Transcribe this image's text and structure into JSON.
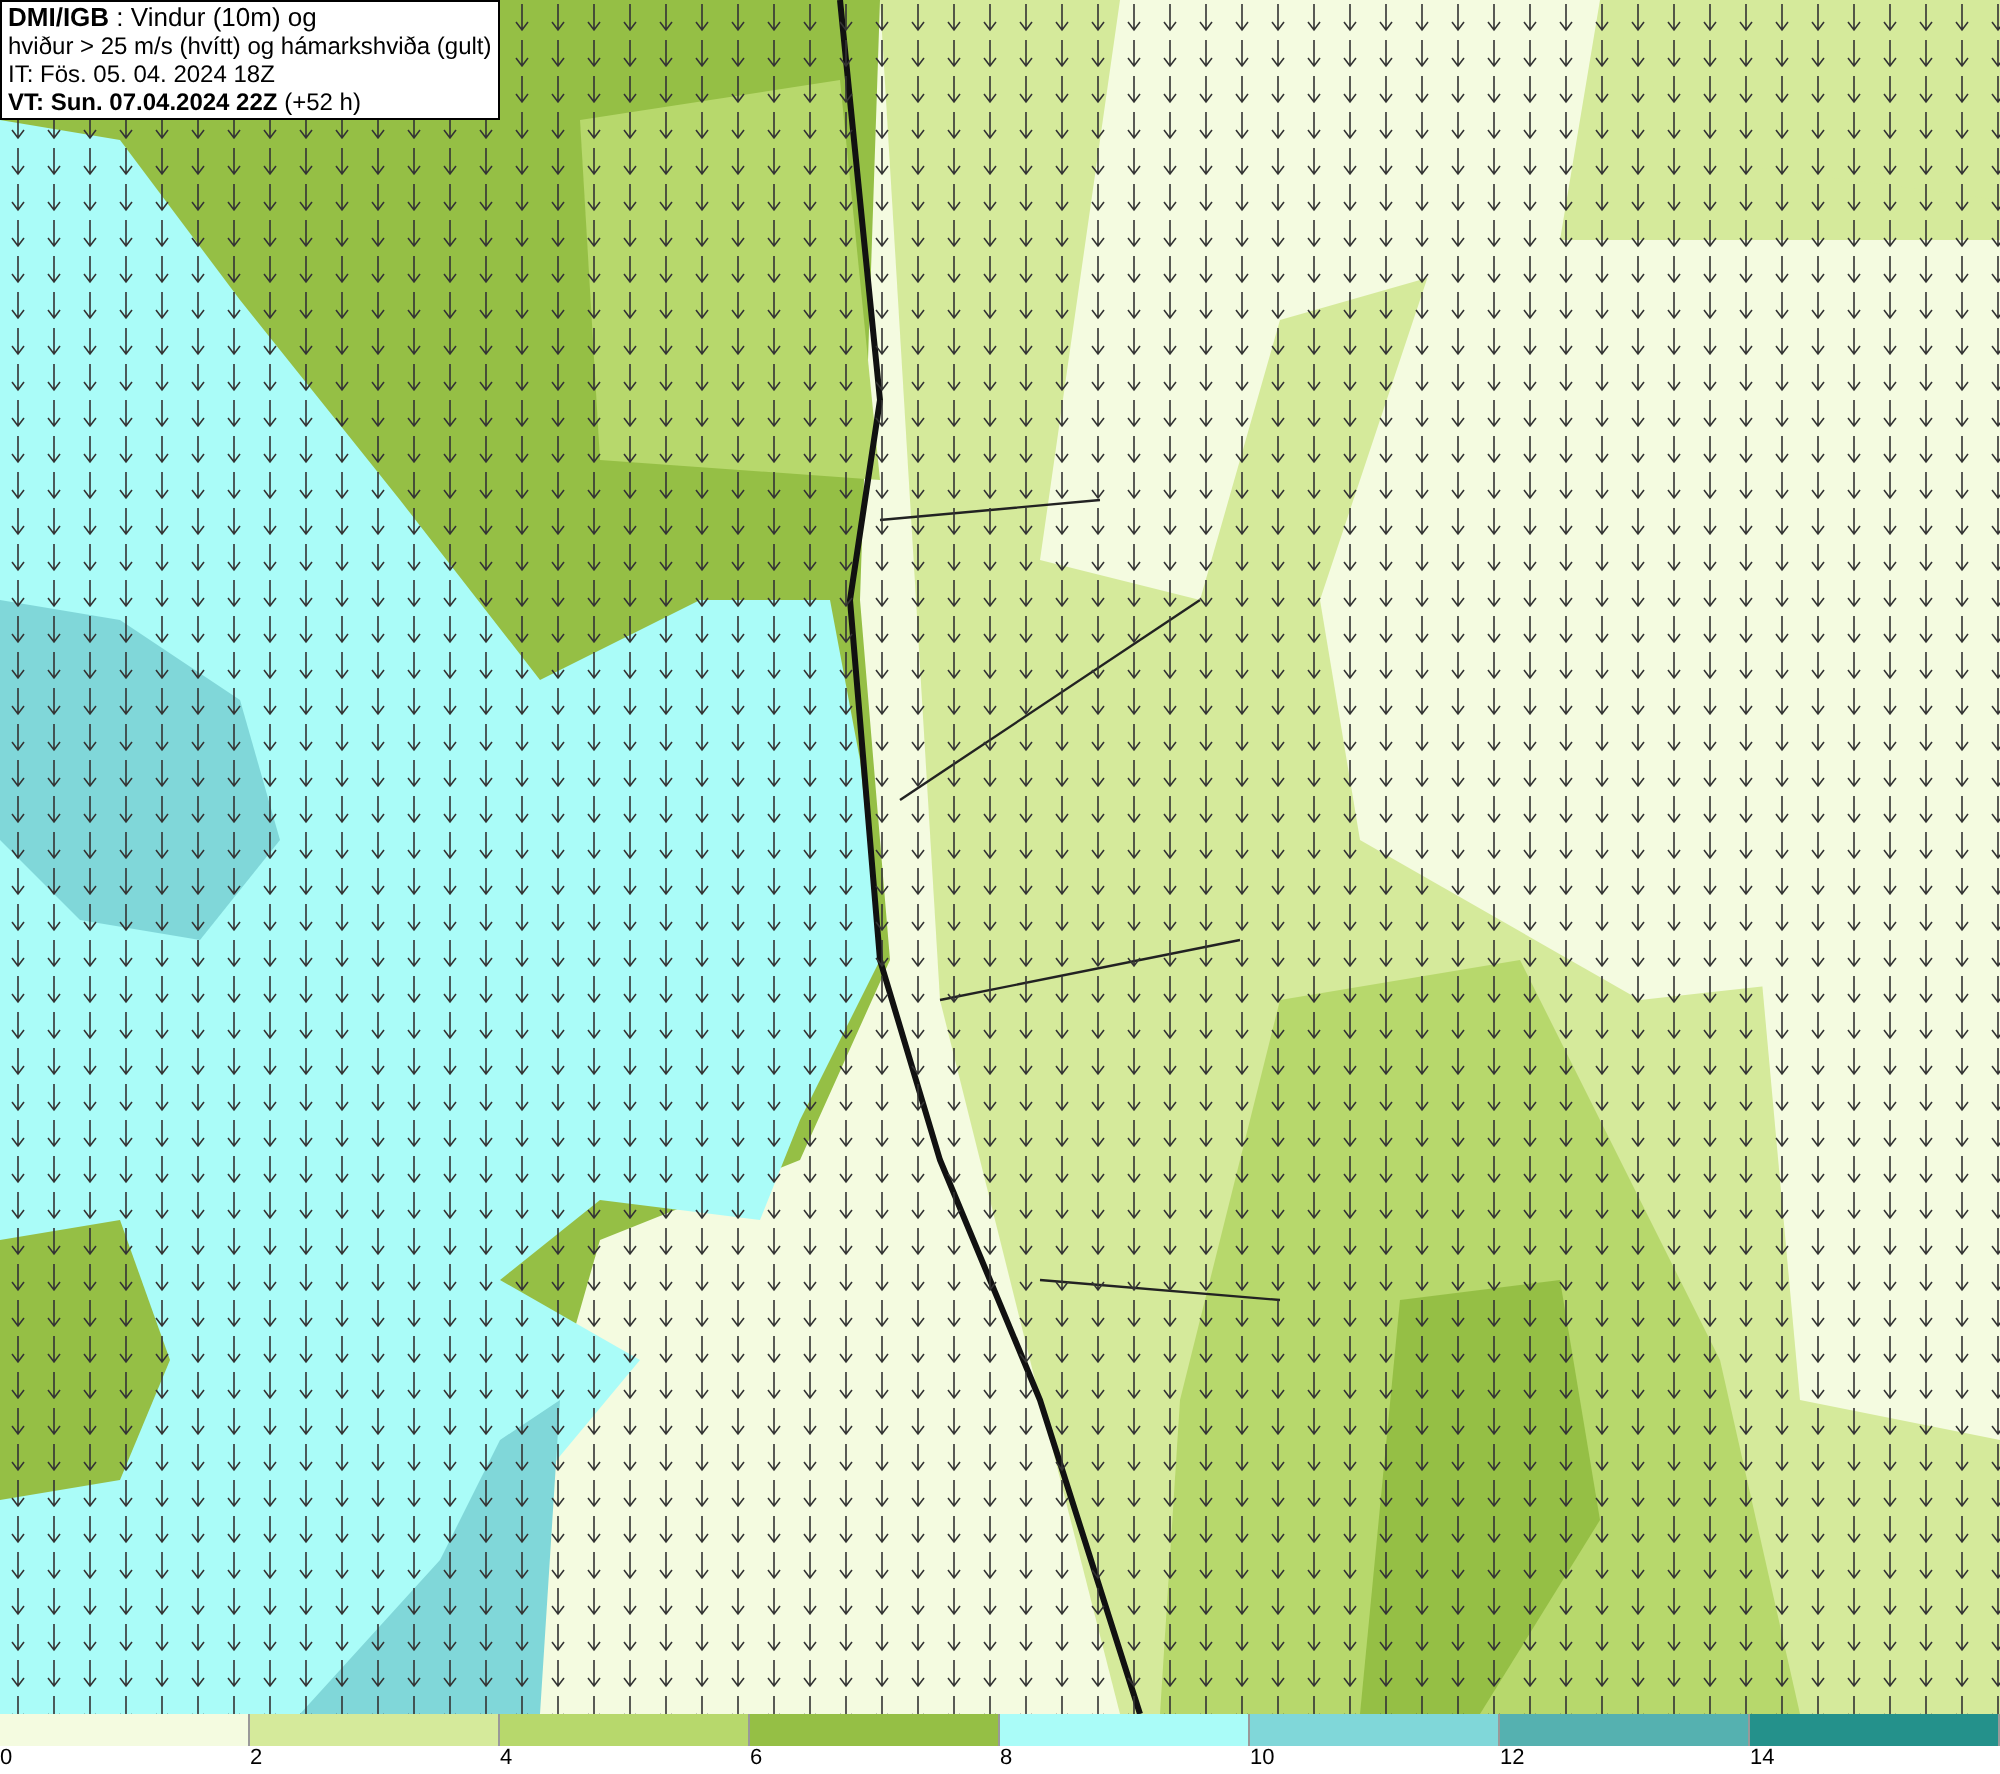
{
  "header": {
    "lines": [
      "**DMI/IGB** : Vindur (10m) og",
      "hviður > 25 m/s (hvítt) og hámarkshviða (gult)",
      "IT: Fös. 05. 04. 2024 18Z",
      "**VT: Sun. 07.04.2024 22Z** (+52 h)"
    ]
  },
  "legend": [
    {
      "label": "0",
      "color": "#f4fbe0"
    },
    {
      "label": "2",
      "color": "#d5ea9b"
    },
    {
      "label": "4",
      "color": "#b7d86c"
    },
    {
      "label": "6",
      "color": "#95bf45"
    },
    {
      "label": "8",
      "color": "#aafcf8"
    },
    {
      "label": "10",
      "color": "#80d7d9"
    },
    {
      "label": "12",
      "color": "#55b1b0"
    },
    {
      "label": "14",
      "color": "#24918b"
    }
  ]
}
